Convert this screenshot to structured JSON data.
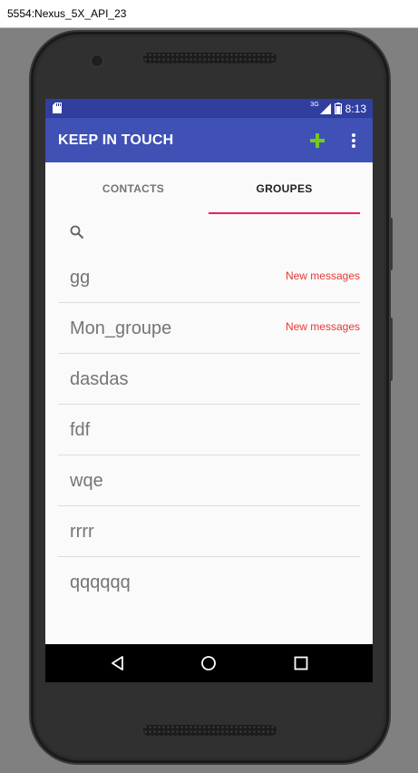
{
  "window": {
    "title": "5554:Nexus_5X_API_23"
  },
  "status_bar": {
    "network_label": "3G",
    "time": "8:13"
  },
  "app_bar": {
    "title": "KEEP IN TOUCH"
  },
  "tabs": [
    {
      "label": "CONTACTS",
      "selected": false
    },
    {
      "label": "GROUPES",
      "selected": true
    }
  ],
  "groups": [
    {
      "name": "gg",
      "badge": "New messages"
    },
    {
      "name": "Mon_groupe",
      "badge": "New messages"
    },
    {
      "name": "dasdas",
      "badge": ""
    },
    {
      "name": "fdf",
      "badge": ""
    },
    {
      "name": "wqe",
      "badge": ""
    },
    {
      "name": "rrrr",
      "badge": ""
    },
    {
      "name": "qqqqqq",
      "badge": ""
    }
  ],
  "colors": {
    "primary": "#3f51b5",
    "primary_dark": "#303f9f",
    "accent": "#e91e63",
    "add_icon": "#76c722",
    "badge": "#e53935"
  },
  "icons": {
    "sd_card": "sd-card-icon",
    "signal": "signal-icon",
    "battery": "battery-icon",
    "add": "add-icon",
    "more": "more-vert-icon",
    "search": "search-icon",
    "nav_back": "back-icon",
    "nav_home": "home-icon",
    "nav_recents": "recents-icon"
  }
}
